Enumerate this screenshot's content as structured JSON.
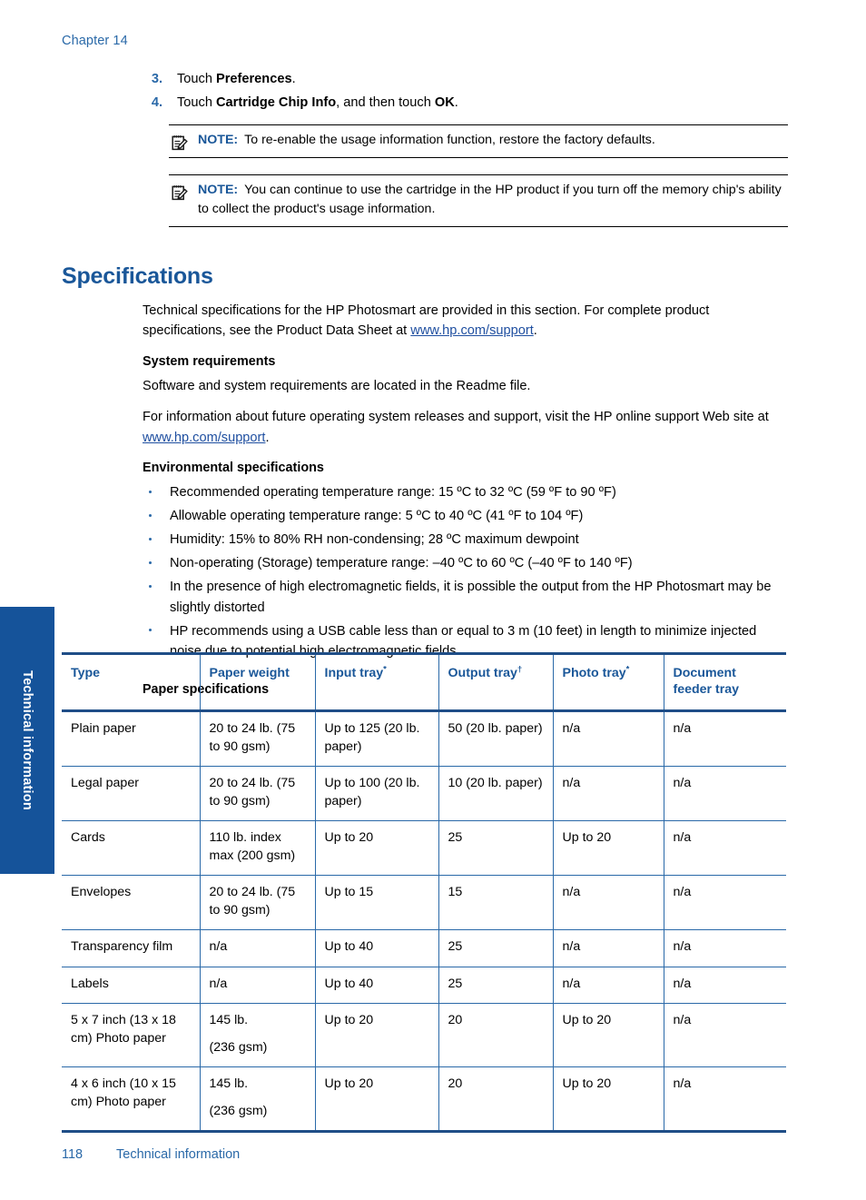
{
  "running_head": "Chapter 14",
  "steps": [
    {
      "num": "3.",
      "prefix": "Touch ",
      "bold": "Preferences",
      "suffix": "."
    },
    {
      "num": "4.",
      "prefix": "Touch ",
      "bold": "Cartridge Chip Info",
      "mid": ", and then touch ",
      "bold2": "OK",
      "suffix": "."
    }
  ],
  "notes": [
    {
      "icon": "note-pencil-icon",
      "label": "NOTE:",
      "text": "To re-enable the usage information function, restore the factory defaults."
    },
    {
      "icon": "note-pencil-icon",
      "label": "NOTE:",
      "text": "You can continue to use the cartridge in the HP product if you turn off the memory chip's ability to collect the product's usage information."
    }
  ],
  "heading": "Specifications",
  "intro": {
    "part1": "Technical specifications for the HP Photosmart are provided in this section. For complete product specifications, see the Product Data Sheet at ",
    "link": "www.hp.com/support",
    "part2": "."
  },
  "system_requirements": {
    "heading": "System requirements",
    "para1": "Software and system requirements are located in the Readme file.",
    "para2_part1": "For information about future operating system releases and support, visit the HP online support Web site at ",
    "link": "www.hp.com/support",
    "para2_part2": "."
  },
  "environmental": {
    "heading": "Environmental specifications",
    "bullets": [
      "Recommended operating temperature range: 15 ºC to 32 ºC (59 ºF to 90 ºF)",
      "Allowable operating temperature range: 5 ºC to 40 ºC (41 ºF to 104 ºF)",
      "Humidity: 15% to 80% RH non-condensing; 28 ºC maximum dewpoint",
      "Non-operating (Storage) temperature range: –40 ºC to 60 ºC (–40 ºF to 140 ºF)",
      "In the presence of high electromagnetic fields, it is possible the output from the HP Photosmart may be slightly distorted",
      "HP recommends using a USB cable less than or equal to 3 m (10 feet) in length to minimize injected noise due to potential high electromagnetic fields"
    ]
  },
  "paper_specifications": {
    "title": "Paper specifications",
    "columns": [
      {
        "label": "Type",
        "mark": ""
      },
      {
        "label": "Paper weight",
        "mark": ""
      },
      {
        "label": "Input tray",
        "mark": "*"
      },
      {
        "label": "Output tray",
        "mark": "†"
      },
      {
        "label": "Photo tray",
        "mark": "*"
      },
      {
        "label": "Document feeder tray",
        "mark": ""
      }
    ],
    "rows": [
      {
        "type": "Plain paper",
        "weight": "20 to 24 lb. (75 to 90 gsm)",
        "weight_sub": "",
        "input_tray": "Up to 125 (20 lb. paper)",
        "output_tray": "50 (20 lb. paper)",
        "photo_tray": "n/a",
        "document_feeder_tray": "n/a"
      },
      {
        "type": "Legal paper",
        "weight": "20 to 24 lb. (75 to 90 gsm)",
        "weight_sub": "",
        "input_tray": "Up to 100 (20 lb. paper)",
        "output_tray": "10 (20 lb. paper)",
        "photo_tray": "n/a",
        "document_feeder_tray": "n/a"
      },
      {
        "type": "Cards",
        "weight": "110 lb. index max (200 gsm)",
        "weight_sub": "",
        "input_tray": "Up to 20",
        "output_tray": "25",
        "photo_tray": "Up to 20",
        "document_feeder_tray": "n/a"
      },
      {
        "type": "Envelopes",
        "weight": "20 to 24 lb. (75 to 90 gsm)",
        "weight_sub": "",
        "input_tray": "Up to 15",
        "output_tray": "15",
        "photo_tray": "n/a",
        "document_feeder_tray": "n/a"
      },
      {
        "type": "Transparency film",
        "weight": "n/a",
        "weight_sub": "",
        "input_tray": "Up to 40",
        "output_tray": "25",
        "photo_tray": "n/a",
        "document_feeder_tray": "n/a"
      },
      {
        "type": "Labels",
        "weight": "n/a",
        "weight_sub": "",
        "input_tray": "Up to 40",
        "output_tray": "25",
        "photo_tray": "n/a",
        "document_feeder_tray": "n/a"
      },
      {
        "type": "5 x 7 inch (13 x 18 cm) Photo paper",
        "weight": "145 lb.",
        "weight_sub": "(236 gsm)",
        "input_tray": "Up to 20",
        "output_tray": "20",
        "photo_tray": "Up to 20",
        "document_feeder_tray": "n/a"
      },
      {
        "type": "4 x 6 inch (10 x 15 cm) Photo paper",
        "weight": "145 lb.",
        "weight_sub": "(236 gsm)",
        "input_tray": "Up to 20",
        "output_tray": "20",
        "photo_tray": "Up to 20",
        "document_feeder_tray": "n/a"
      }
    ]
  },
  "thumb_tab": "Technical information",
  "footer": {
    "page_number": "118",
    "section": "Technical information"
  },
  "colors": {
    "heading_blue": "#1a5799",
    "link_blue": "#1f4fa0",
    "rule_blue": "#1f4e87",
    "cell_border_blue": "#2a69a8",
    "tab_blue": "#15539a"
  }
}
